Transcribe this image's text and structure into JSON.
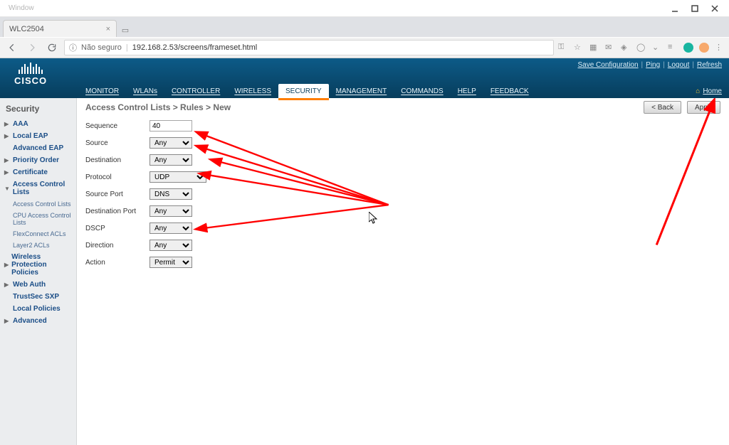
{
  "window": {
    "title_grey": "Window"
  },
  "browser": {
    "tab_title": "WLC2504",
    "insecure_label": "Não seguro",
    "url": "192.168.2.53/screens/frameset.html"
  },
  "header": {
    "brand": "CISCO",
    "nav": [
      "MONITOR",
      "WLANs",
      "CONTROLLER",
      "WIRELESS",
      "SECURITY",
      "MANAGEMENT",
      "COMMANDS",
      "HELP",
      "FEEDBACK"
    ],
    "nav_active_index": 4,
    "right_links": [
      "Save Configuration",
      "Ping",
      "Logout",
      "Refresh"
    ],
    "home": "Home"
  },
  "sidebar": {
    "title": "Security",
    "items": [
      {
        "label": "AAA",
        "type": "closed"
      },
      {
        "label": "Local EAP",
        "type": "closed"
      },
      {
        "label": "Advanced EAP",
        "type": "leaf"
      },
      {
        "label": "Priority Order",
        "type": "closed"
      },
      {
        "label": "Certificate",
        "type": "closed"
      },
      {
        "label": "Access Control Lists",
        "type": "open",
        "children": [
          "Access Control Lists",
          "CPU Access Control Lists",
          "FlexConnect ACLs",
          "Layer2 ACLs"
        ]
      },
      {
        "label": "Wireless Protection Policies",
        "type": "closed"
      },
      {
        "label": "Web Auth",
        "type": "closed"
      },
      {
        "label": "TrustSec SXP",
        "type": "leaf"
      },
      {
        "label": "Local Policies",
        "type": "leaf"
      },
      {
        "label": "Advanced",
        "type": "closed"
      }
    ]
  },
  "content": {
    "breadcrumb": "Access Control Lists > Rules > New",
    "buttons": {
      "back": "< Back",
      "apply": "Apply"
    },
    "form": {
      "sequence": {
        "label": "Sequence",
        "value": "40"
      },
      "source": {
        "label": "Source",
        "value": "Any"
      },
      "destination": {
        "label": "Destination",
        "value": "Any"
      },
      "protocol": {
        "label": "Protocol",
        "value": "UDP"
      },
      "source_port": {
        "label": "Source Port",
        "value": "DNS"
      },
      "destination_port": {
        "label": "Destination Port",
        "value": "Any"
      },
      "dscp": {
        "label": "DSCP",
        "value": "Any"
      },
      "direction": {
        "label": "Direction",
        "value": "Any"
      },
      "action": {
        "label": "Action",
        "value": "Permit"
      }
    }
  }
}
